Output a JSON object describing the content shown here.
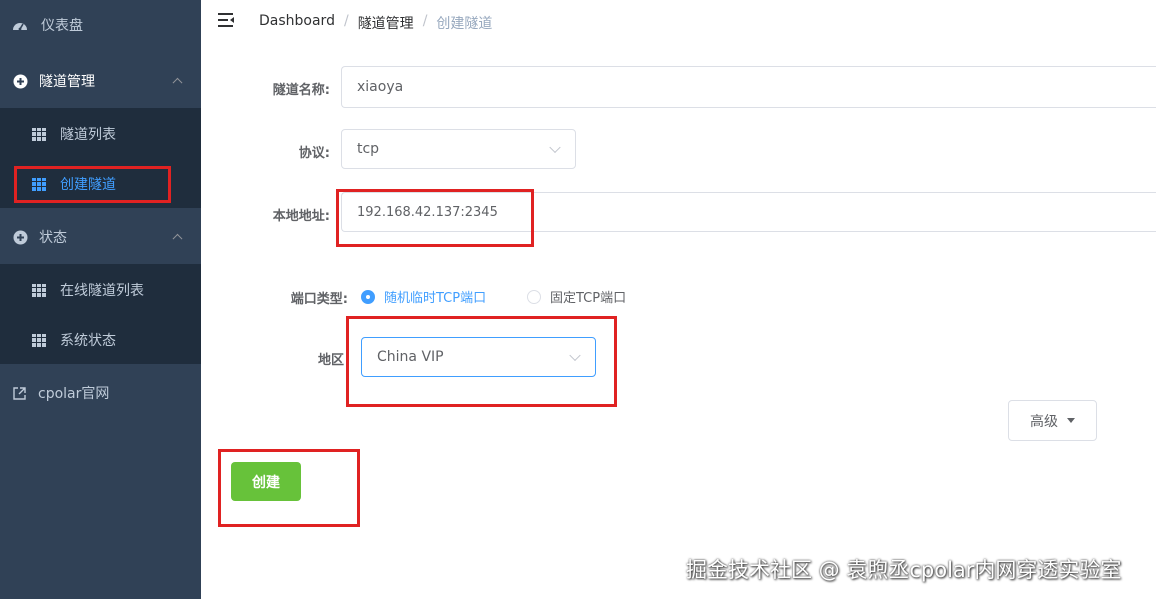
{
  "sidebar": {
    "dashboard": "仪表盘",
    "tunnel_mgmt": "隧道管理",
    "tunnel_list": "隧道列表",
    "create_tunnel": "创建隧道",
    "status": "状态",
    "online_tunnel_list": "在线隧道列表",
    "system_status": "系统状态",
    "cpolar_site": "cpolar官网"
  },
  "breadcrumb": {
    "home": "Dashboard",
    "sep": "/",
    "section": "隧道管理",
    "current": "创建隧道"
  },
  "form": {
    "name_label": "隧道名称:",
    "name_value": "xiaoya",
    "protocol_label": "协议:",
    "protocol_value": "tcp",
    "local_addr_label": "本地地址:",
    "local_addr_value": "192.168.42.137:2345",
    "port_type_label": "端口类型:",
    "port_random": "随机临时TCP端口",
    "port_fixed": "固定TCP端口",
    "region_label": "地区",
    "region_value": "China VIP",
    "advanced_button": "高级",
    "create_button": "创建"
  },
  "watermark": "掘金技术社区 @ 袁煦丞cpolar内网穿透实验室",
  "colors": {
    "sidebar_bg": "#304156",
    "submenu_bg": "#1f2d3d",
    "accent": "#409eff",
    "create_button": "#67c23a",
    "highlight_box": "#e02222"
  }
}
